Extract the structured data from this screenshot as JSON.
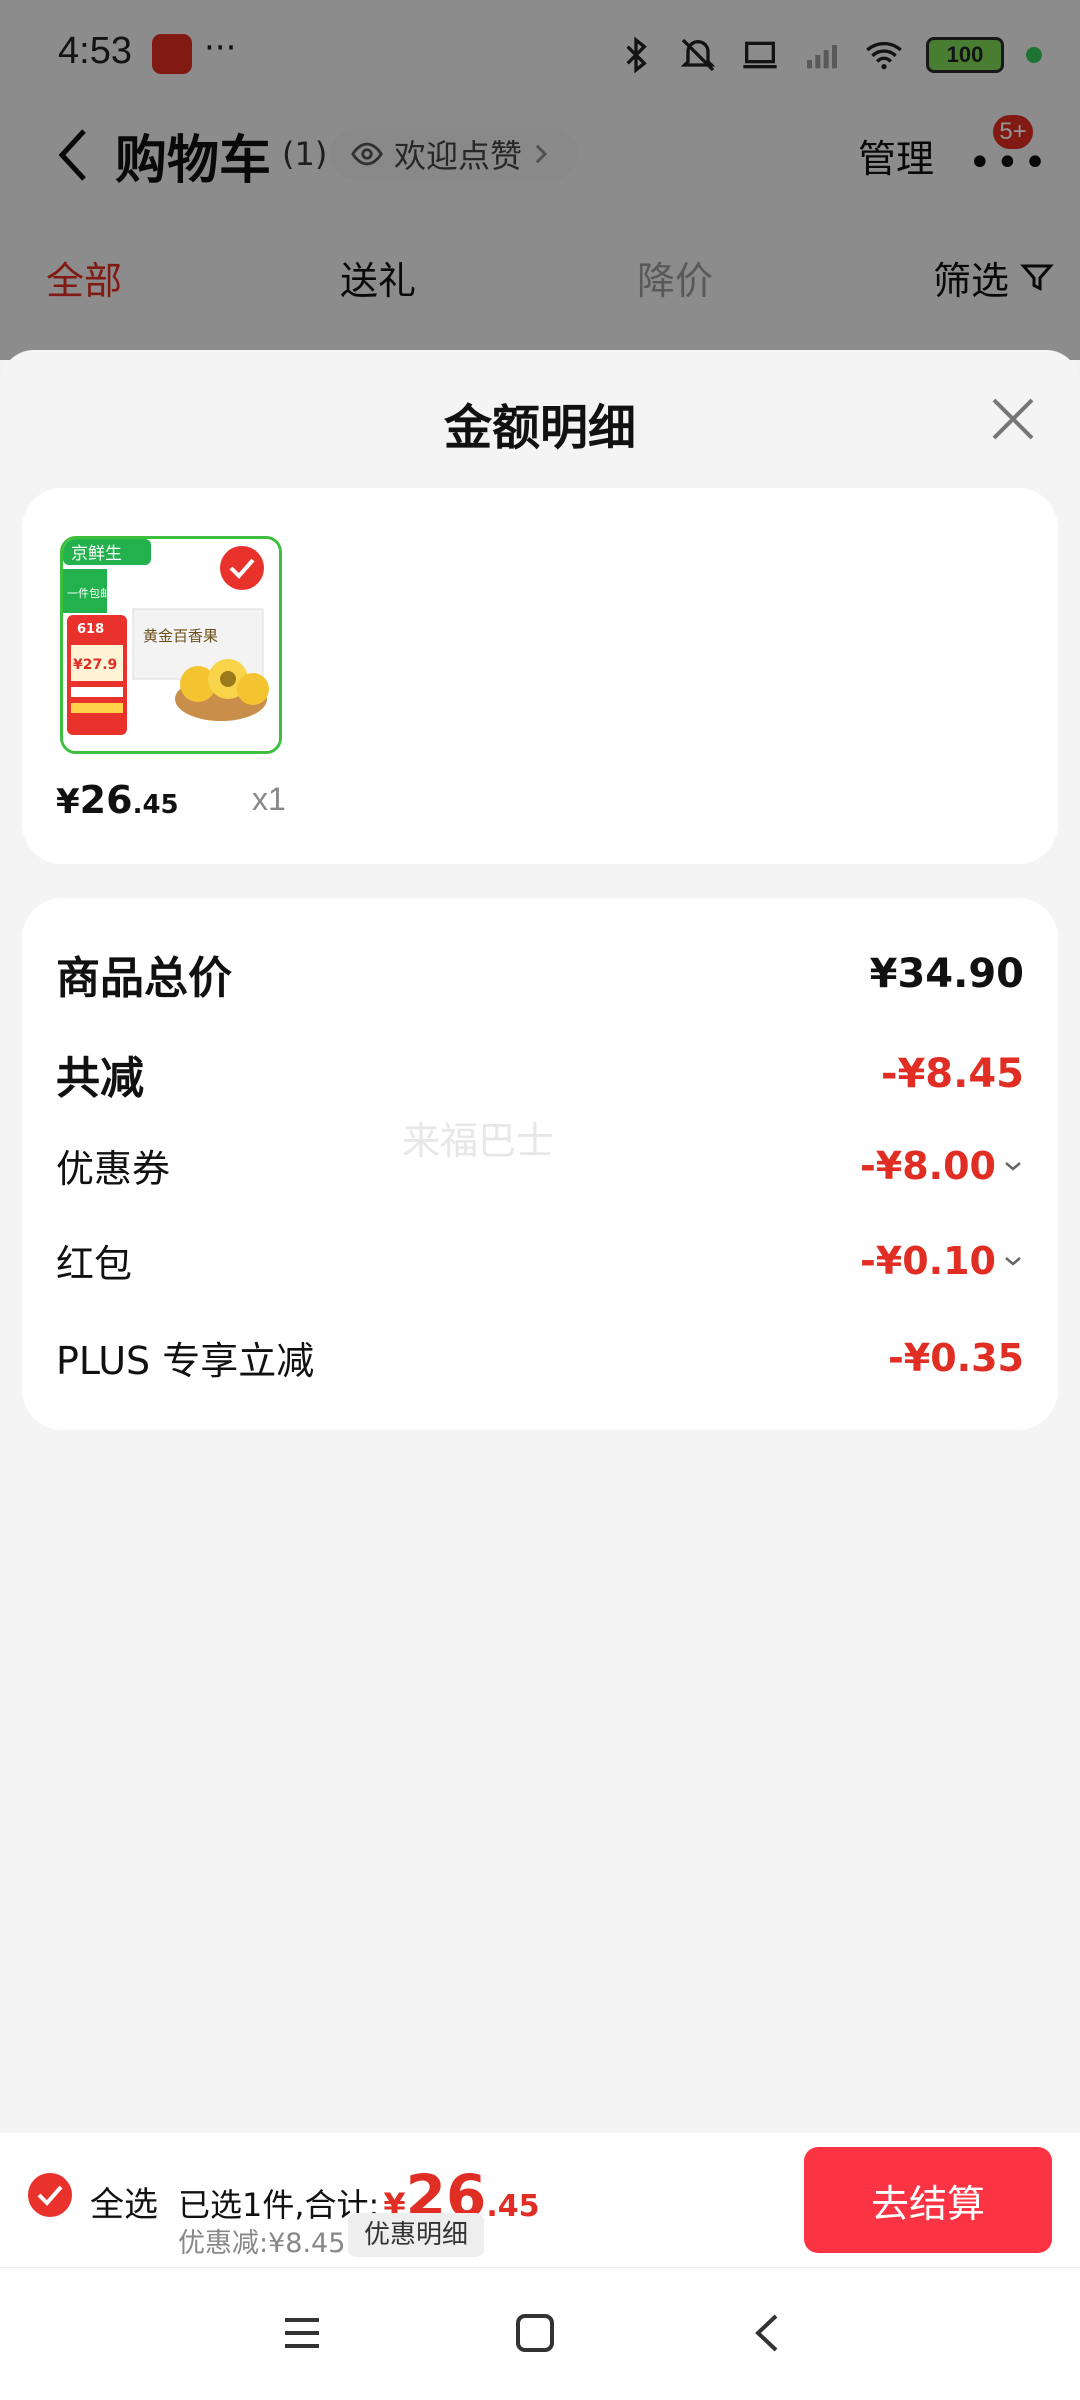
{
  "status_bar": {
    "time": "4:53",
    "more": "···",
    "battery": "100"
  },
  "nav": {
    "title": "购物车",
    "count": "(1)",
    "pill_label": "欢迎点赞",
    "manage": "管理",
    "badge": "5+"
  },
  "tabs": [
    {
      "label": "全部"
    },
    {
      "label": "送礼"
    },
    {
      "label": "降价"
    }
  ],
  "filter_label": "筛选",
  "sheet": {
    "title": "金额明细",
    "product": {
      "price_yen": "¥",
      "price_int": "26",
      "price_dec": ".45",
      "quantity": "x1",
      "thumb_texts": {
        "brand": "京鲜生",
        "free_ship": "一件包邮",
        "sale": "618",
        "promo_price": "¥27.9",
        "product_name": "黄金百香果"
      }
    },
    "details": {
      "total_label": "商品总价",
      "total_value": "¥34.90",
      "reduce_label": "共减",
      "reduce_value": "-¥8.45",
      "coupon_label": "优惠券",
      "coupon_value": "-¥8.00",
      "redpacket_label": "红包",
      "redpacket_value": "-¥0.10",
      "plus_label": "PLUS 专享立减",
      "plus_value": "-¥0.35"
    },
    "watermark": "来福巴士"
  },
  "checkout": {
    "select_all": "全选",
    "selected_text": "已选1件,合计:",
    "total_yen": "¥",
    "total_int": "26",
    "total_dec": ".45",
    "discount_text": "优惠减:¥8.45",
    "detail_button": "优惠明细",
    "submit": "去结算"
  },
  "colors": {
    "accent_red": "#e02e24",
    "button_red": "#fb3343",
    "fresh_green": "#3dbf3d"
  },
  "icons": [
    "back-icon",
    "eye-icon",
    "chevron-right-icon",
    "filter-icon",
    "close-icon",
    "check-circle-icon",
    "chevron-down-icon",
    "menu-icon",
    "home-icon",
    "back-nav-icon"
  ]
}
